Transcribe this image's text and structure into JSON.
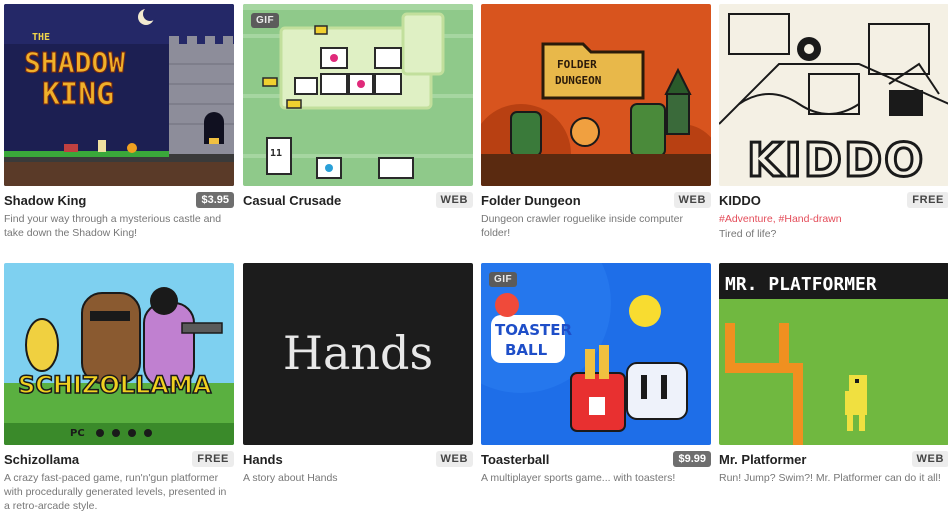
{
  "games": [
    {
      "title": "Shadow King",
      "price": "$3.95",
      "price_kind": "paid",
      "gif": "",
      "tags": "",
      "description": "Find your way through a mysterious castle and take down the Shadow King!",
      "art_text": [
        "THE",
        "SHADOW",
        "KING"
      ]
    },
    {
      "title": "Casual Crusade",
      "price": "WEB",
      "price_kind": "tag",
      "gif": "GIF",
      "tags": "",
      "description": "",
      "art_text": [
        "11"
      ]
    },
    {
      "title": "Folder Dungeon",
      "price": "WEB",
      "price_kind": "tag",
      "gif": "",
      "tags": "",
      "description": "Dungeon crawler roguelike inside computer folder!",
      "art_text": [
        "FOLDER",
        "DUNGEON"
      ]
    },
    {
      "title": "KIDDO",
      "price": "FREE",
      "price_kind": "tag",
      "gif": "",
      "tags": "#Adventure, #Hand-drawn",
      "description": "Tired of life?",
      "art_text": [
        "KIDDO"
      ]
    },
    {
      "title": "Schizollama",
      "price": "FREE",
      "price_kind": "tag",
      "gif": "",
      "tags": "",
      "description": "A crazy fast-paced game, run'n'gun platformer with procedurally generated levels, presented in a retro-arcade style.",
      "art_text": [
        "SCHIZOLLAMA",
        "PC"
      ]
    },
    {
      "title": "Hands",
      "price": "WEB",
      "price_kind": "tag",
      "gif": "",
      "tags": "",
      "description": "A story about Hands",
      "art_text": [
        "Hands"
      ]
    },
    {
      "title": "Toasterball",
      "price": "$9.99",
      "price_kind": "paid",
      "gif": "GIF",
      "tags": "",
      "description": "A multiplayer sports game... with toasters!",
      "art_text": [
        "TOASTER",
        "BALL"
      ]
    },
    {
      "title": "Mr. Platformer",
      "price": "WEB",
      "price_kind": "tag",
      "gif": "",
      "tags": "",
      "description": "Run! Jump? Swim?! Mr. Platformer can do it all!",
      "art_text": [
        "MR. PLATFORMER"
      ]
    }
  ]
}
